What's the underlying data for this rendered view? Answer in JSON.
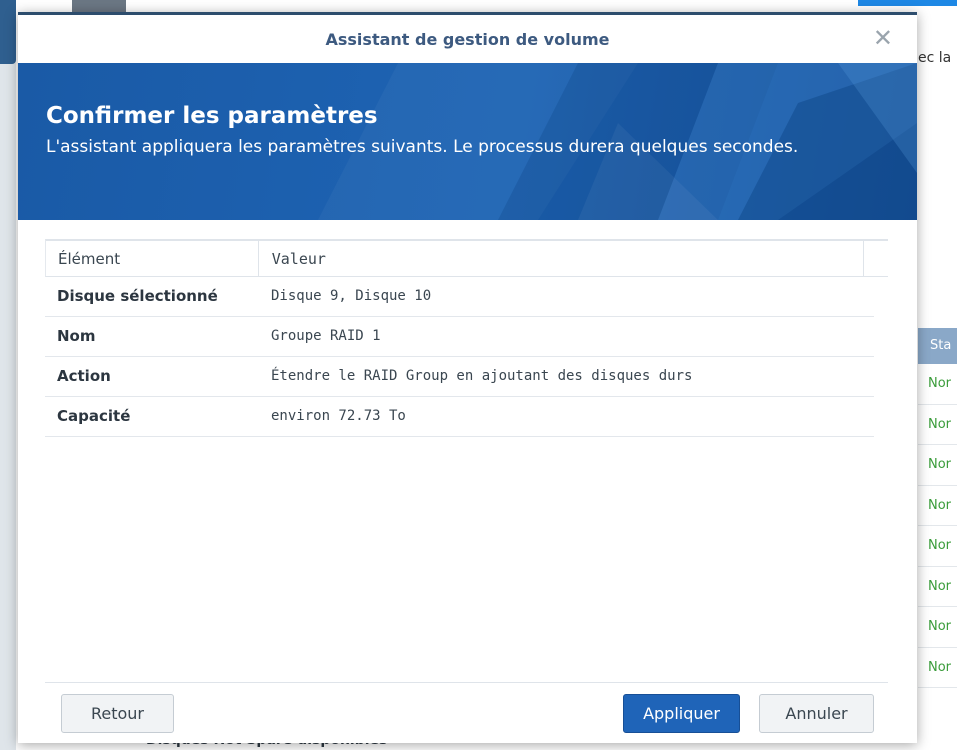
{
  "background": {
    "right_text": "ec la",
    "status_header": "Sta",
    "status_cells": [
      "Nor",
      "Nor",
      "Nor",
      "Nor",
      "Nor",
      "Nor",
      "Nor",
      "Nor"
    ],
    "bottom_text": "Disques Hot Spare disponibles"
  },
  "dialog": {
    "title": "Assistant de gestion de volume",
    "banner": {
      "title": "Confirmer les paramètres",
      "subtitle": "L'assistant appliquera les paramètres suivants. Le processus durera quelques secondes."
    },
    "table": {
      "headers": [
        "Élément",
        "Valeur"
      ],
      "rows": [
        {
          "label": "Disque sélectionné",
          "value": "Disque 9, Disque 10"
        },
        {
          "label": "Nom",
          "value": "Groupe RAID 1"
        },
        {
          "label": "Action",
          "value": "Étendre le RAID Group en ajoutant des disques durs"
        },
        {
          "label": "Capacité",
          "value": "environ 72.73 To"
        }
      ]
    },
    "buttons": {
      "back": "Retour",
      "apply": "Appliquer",
      "cancel": "Annuler"
    }
  },
  "colors": {
    "banner_blue": "#1e64b4",
    "apply_button": "#1f64b8",
    "status_green": "#3a9c3a"
  }
}
